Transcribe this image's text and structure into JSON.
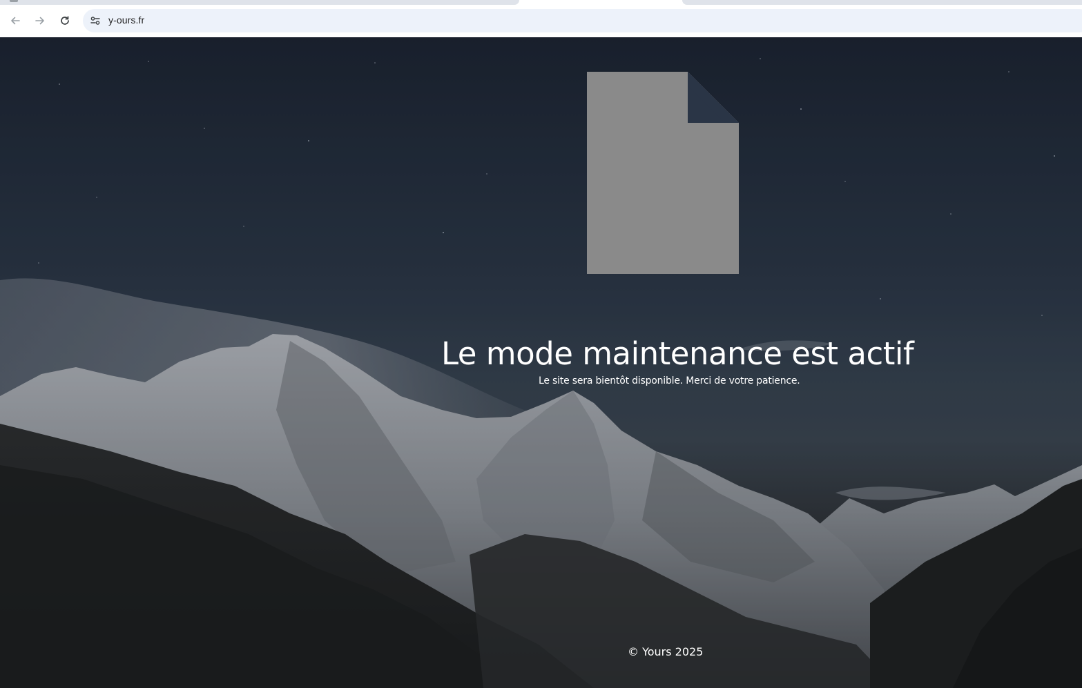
{
  "browser": {
    "url": "y-ours.fr",
    "back_icon": "arrow-left-icon",
    "forward_icon": "arrow-right-icon",
    "reload_icon": "reload-icon",
    "site_info_icon": "tune-icon"
  },
  "page": {
    "illustration_icon": "document-icon",
    "title": "Le mode maintenance est actif",
    "subtitle": "Le site sera bientôt disponible. Merci de votre patience.",
    "footer": "© Yours 2025"
  },
  "colors": {
    "omnibox_bg": "#edf2fa",
    "icon_gray": "#8a8a8a",
    "text": "#ffffff"
  }
}
